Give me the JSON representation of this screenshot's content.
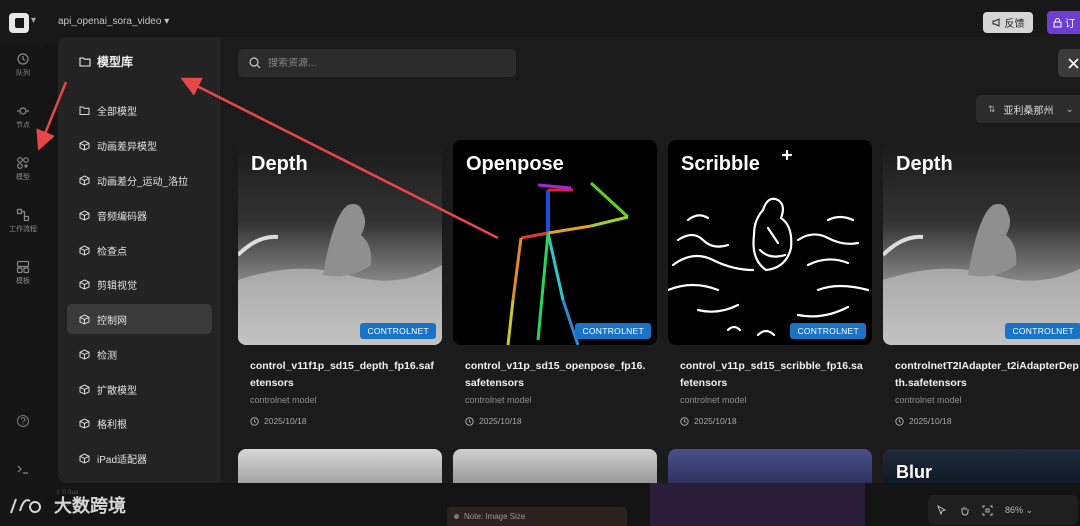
{
  "topbar": {
    "workflow_name": "api_openai_sora_video",
    "feedback_label": "反馈",
    "subscribe_label": "订"
  },
  "rail": {
    "items": [
      {
        "label": "队列",
        "icon": "history-icon"
      },
      {
        "label": "节点",
        "icon": "node-icon"
      },
      {
        "label": "模型",
        "icon": "model-icon"
      },
      {
        "label": "工作流程",
        "icon": "workflow-icon"
      },
      {
        "label": "模板",
        "icon": "template-icon"
      }
    ]
  },
  "modal": {
    "title": "模型库",
    "search_placeholder": "搜索资源...",
    "sort_label": "亚利桑那州",
    "categories": [
      {
        "label": "全部模型",
        "active": false
      },
      {
        "label": "动画差异模型",
        "active": false
      },
      {
        "label": "动画差分_运动_洛拉",
        "active": false
      },
      {
        "label": "音频编码器",
        "active": false
      },
      {
        "label": "检查点",
        "active": false
      },
      {
        "label": "剪辑视觉",
        "active": false
      },
      {
        "label": "控制网",
        "active": true
      },
      {
        "label": "检测",
        "active": false
      },
      {
        "label": "扩散模型",
        "active": false
      },
      {
        "label": "格利根",
        "active": false
      },
      {
        "label": "iPad适配器",
        "active": false
      }
    ],
    "cards": [
      {
        "title": "Depth",
        "badge": "CONTROLNET",
        "name": "control_v11f1p_sd15_depth_fp16.safetensors",
        "sub": "controlnet model",
        "date": "2025/10/18"
      },
      {
        "title": "Openpose",
        "badge": "CONTROLNET",
        "name": "control_v11p_sd15_openpose_fp16.safetensors",
        "sub": "controlnet model",
        "date": "2025/10/18"
      },
      {
        "title": "Scribble",
        "badge": "CONTROLNET",
        "name": "control_v11p_sd15_scribble_fp16.safetensors",
        "sub": "controlnet model",
        "date": "2025/10/18"
      },
      {
        "title": "Depth",
        "badge": "CONTROLNET",
        "name": "controlnetT2IAdapter_t2iAdapterDepth.safetensors",
        "sub": "controlnet model",
        "date": "2025/10/18"
      }
    ],
    "next_row": [
      {
        "title": ""
      },
      {
        "title": ""
      },
      {
        "title": ""
      },
      {
        "title": "Blur"
      }
    ]
  },
  "bottom": {
    "fps_line1": "t: 0.0us",
    "fps_line2": "FPS:60.98",
    "note_label": "Note: Image Size",
    "zoom": "86%",
    "watermark": "大数跨境"
  },
  "colors": {
    "accent": "#1a73c4",
    "subscribe": "#6b3fd0",
    "annotation_arrow": "#e8474a"
  }
}
